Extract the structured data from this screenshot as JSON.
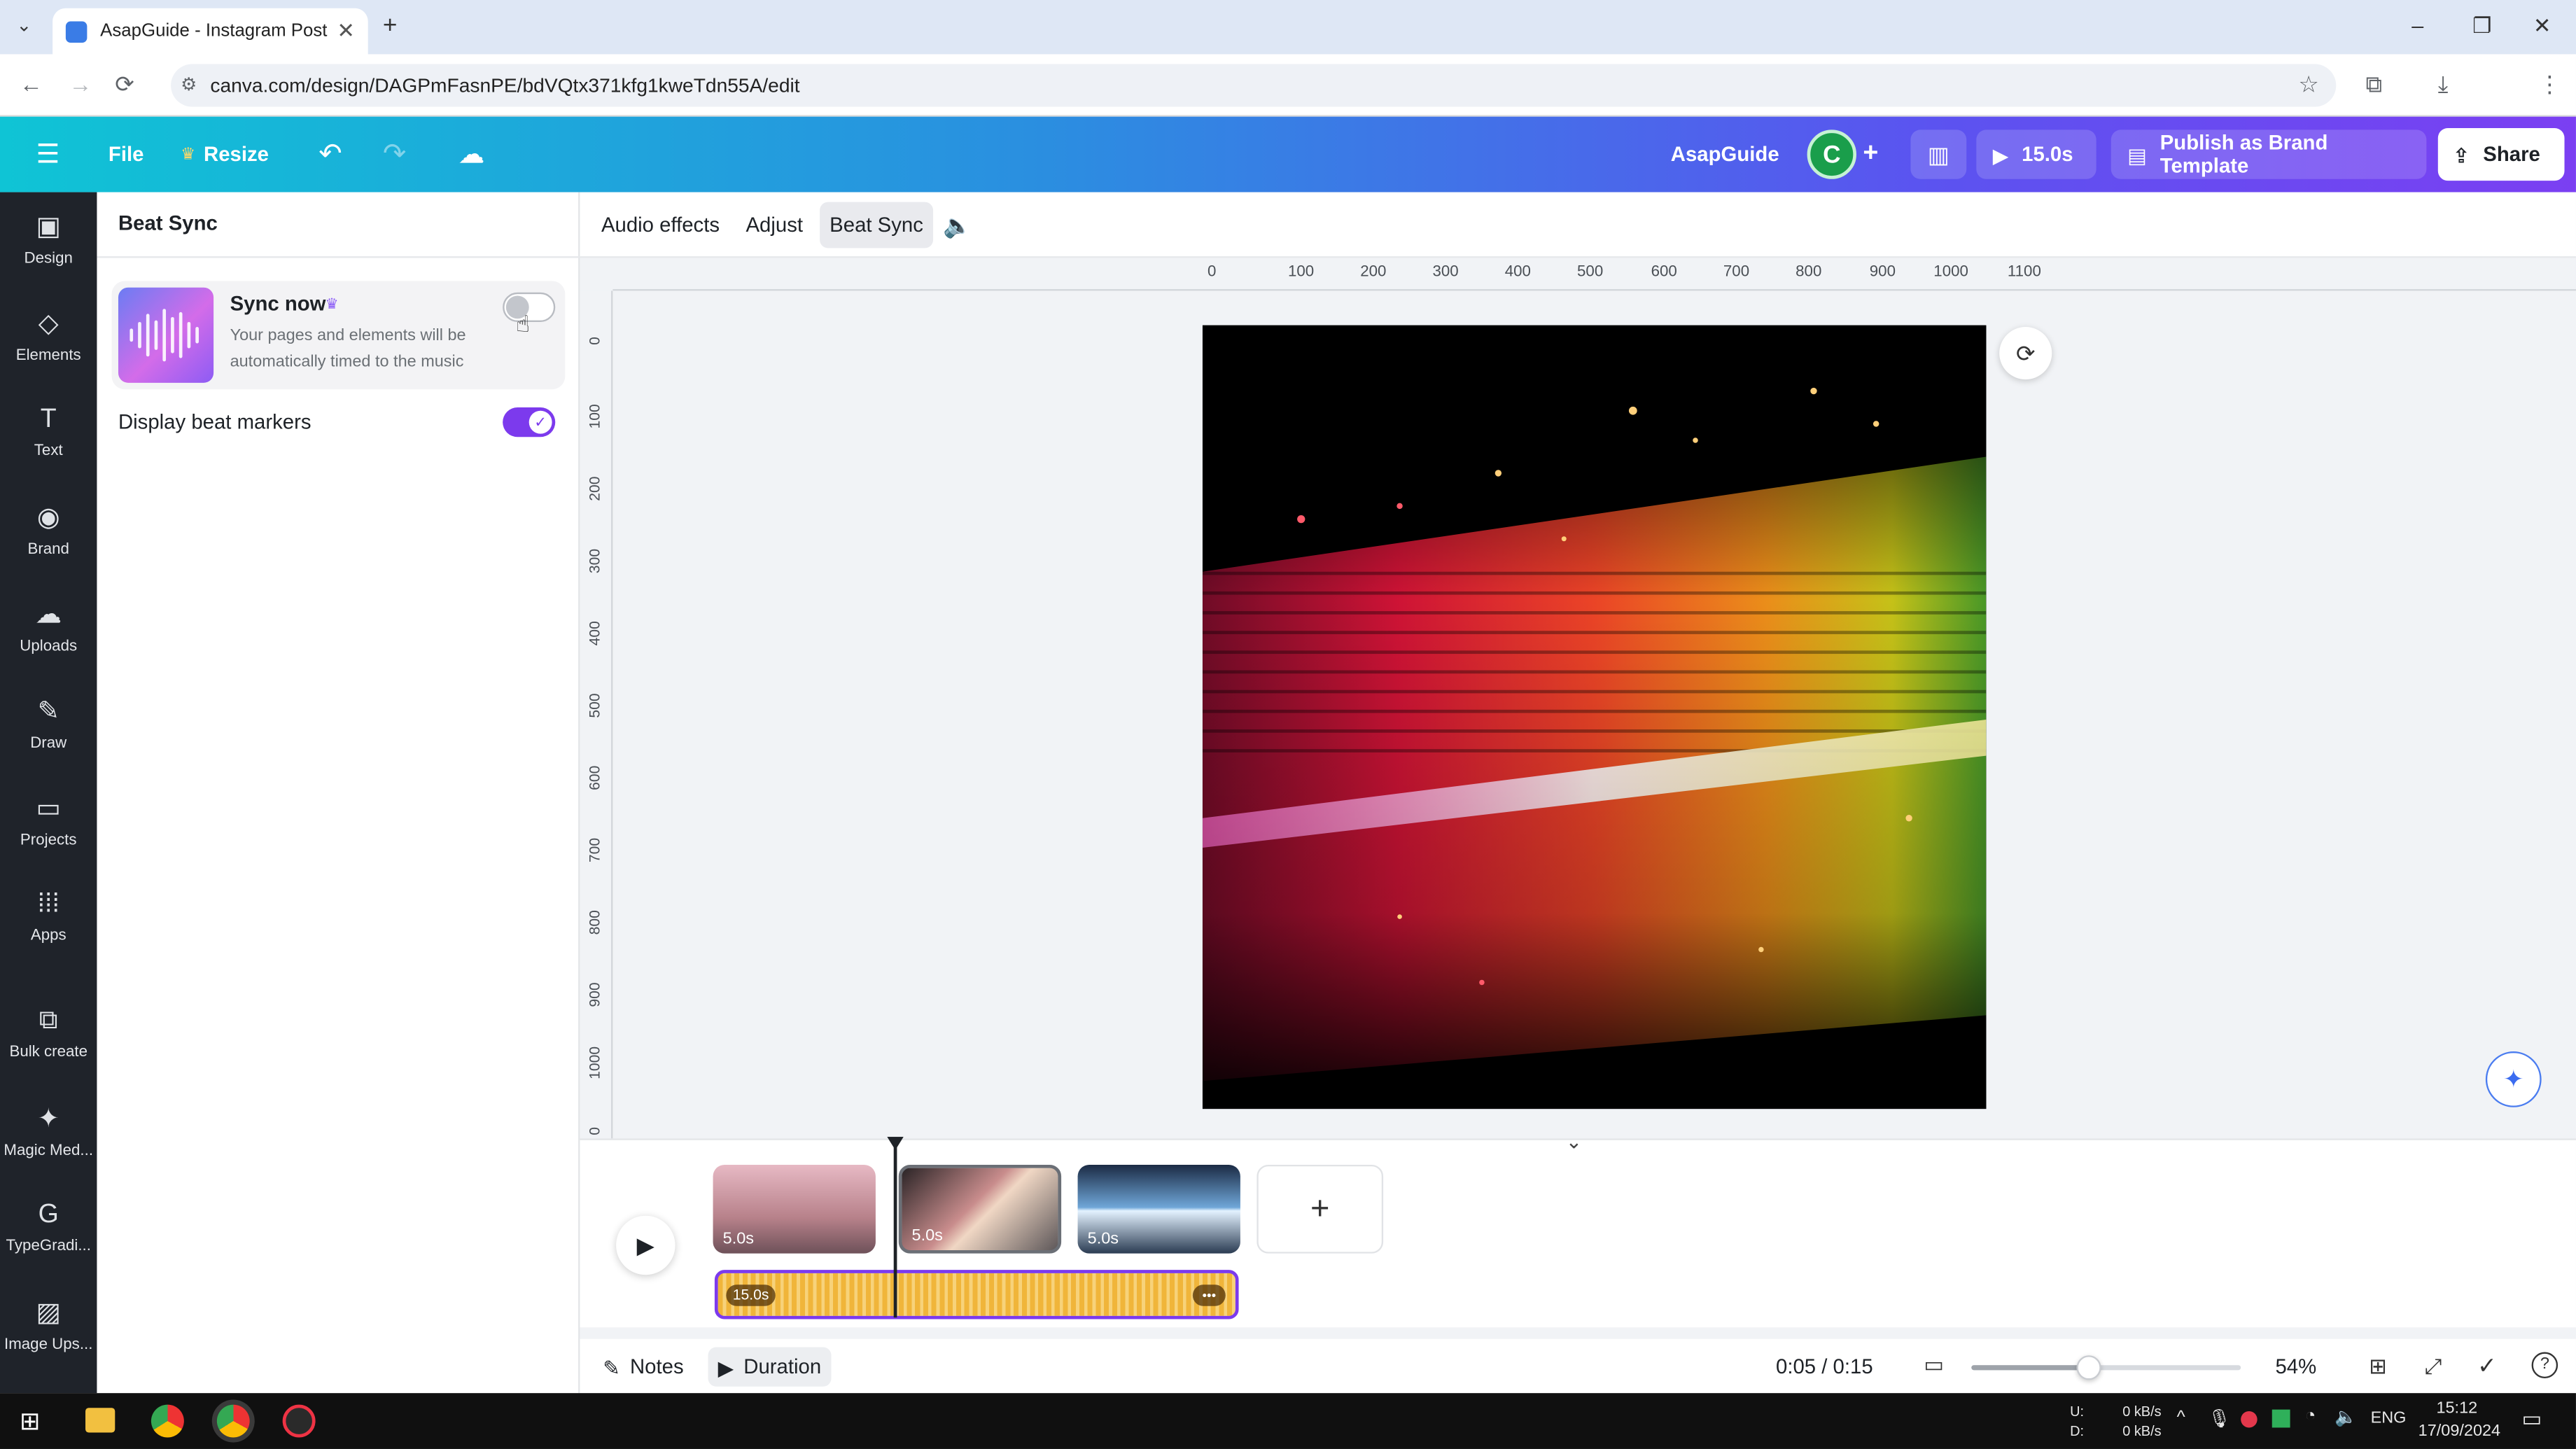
{
  "browser": {
    "tab_title": "AsapGuide - Instagram Post",
    "tab_close": "✕",
    "new_tab": "+",
    "url": "canva.com/design/DAGPmFasnPE/bdVQtx371kfg1kweTdn55A/edit",
    "win_min": "–",
    "win_max": "❐",
    "win_close": "✕"
  },
  "header": {
    "menu_icon": "☰",
    "file": "File",
    "resize": "Resize",
    "resize_crown": "♛",
    "undo": "↶",
    "redo": "↷",
    "cloud": "☁",
    "brand": "AsapGuide",
    "avatar_letter": "C",
    "add": "+",
    "play_duration": "15.0s",
    "publish": "Publish as Brand Template",
    "share": "Share"
  },
  "rail": {
    "items": [
      {
        "label": "Design",
        "icon": "▣"
      },
      {
        "label": "Elements",
        "icon": "◇"
      },
      {
        "label": "Text",
        "icon": "T"
      },
      {
        "label": "Brand",
        "icon": "◉"
      },
      {
        "label": "Uploads",
        "icon": "☁"
      },
      {
        "label": "Draw",
        "icon": "✎"
      },
      {
        "label": "Projects",
        "icon": "▭"
      },
      {
        "label": "Apps",
        "icon": "⁞⁞⁞"
      },
      {
        "label": "Bulk create",
        "icon": "⧉"
      },
      {
        "label": "Magic Med...",
        "icon": "✦"
      },
      {
        "label": "TypeGradi...",
        "icon": "G"
      },
      {
        "label": "Image Ups...",
        "icon": "▨"
      }
    ]
  },
  "panel": {
    "title": "Beat Sync",
    "sync_title": "Sync now",
    "sync_crown": "♛",
    "sync_desc_1": "Your pages and elements will be",
    "sync_desc_2": "automatically timed to the music",
    "sync_enabled": false,
    "beat_markers_label": "Display beat markers",
    "beat_markers_enabled": true
  },
  "toolbar": {
    "audio_effects": "Audio effects",
    "adjust": "Adjust",
    "beat_sync": "Beat Sync",
    "volume_icon": "🔈"
  },
  "rulers": {
    "horizontal": [
      "0",
      "100",
      "200",
      "300",
      "400",
      "500",
      "600",
      "700",
      "800",
      "900",
      "1000",
      "1100"
    ],
    "vertical": [
      "0",
      "100",
      "200",
      "300",
      "400",
      "500",
      "600",
      "700",
      "800",
      "900",
      "1000",
      "0"
    ]
  },
  "timeline": {
    "play_icon": "▶",
    "clips": [
      {
        "duration": "5.0s"
      },
      {
        "duration": "5.0s"
      },
      {
        "duration": "5.0s"
      }
    ],
    "add_clip": "+",
    "audio_duration": "15.0s",
    "audio_menu": "•••",
    "collapse": "⌄"
  },
  "footer": {
    "notes": "Notes",
    "duration": "Duration",
    "time": "0:05 / 0:15",
    "zoom": "54%",
    "zoom_fraction": 0.43
  },
  "taskbar": {
    "net_up_label": "U:",
    "net_down_label": "D:",
    "net_up": "0 kB/s",
    "net_down": "0 kB/s",
    "lang": "ENG",
    "time": "15:12",
    "date": "17/09/2024"
  }
}
